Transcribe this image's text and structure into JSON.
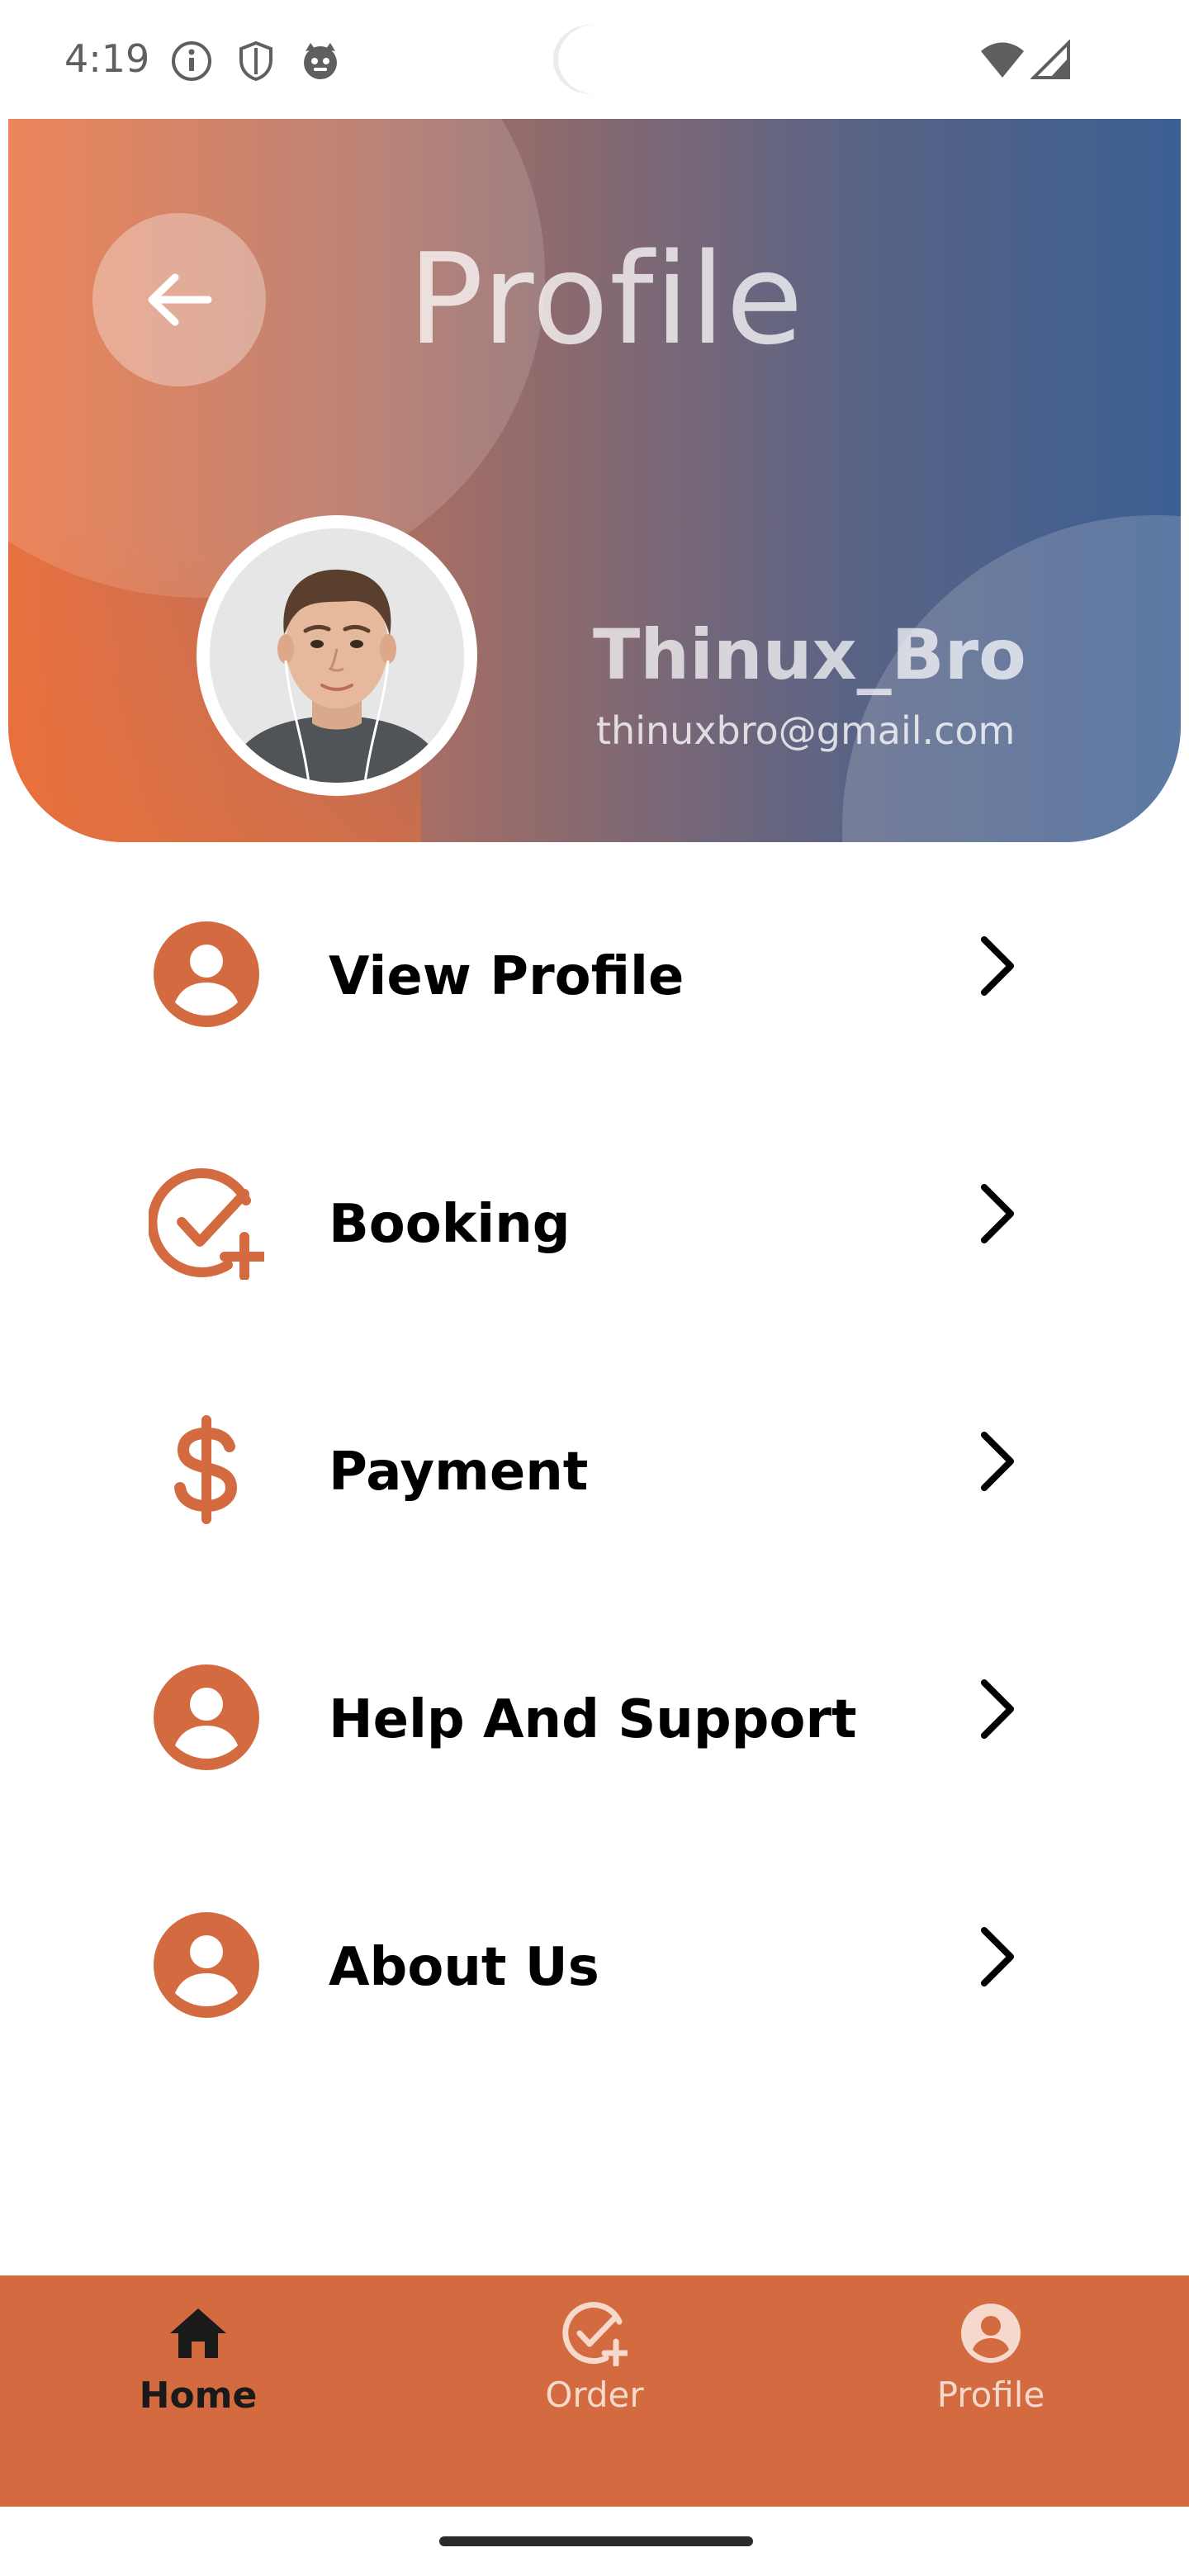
{
  "status_bar": {
    "time": "4:19",
    "left_icons": [
      "info-icon",
      "shield-icon",
      "cat-icon"
    ],
    "right_icons": [
      "wifi-icon",
      "cellular-signal-icon"
    ]
  },
  "header": {
    "title": "Profile",
    "back_icon": "arrow-left-icon",
    "user": {
      "name": "Thinux_Bro",
      "email": "thinuxbro@gmail.com"
    }
  },
  "menu": {
    "items": [
      {
        "label": "View Profile",
        "icon": "person-icon"
      },
      {
        "label": "Booking",
        "icon": "check-plus-icon"
      },
      {
        "label": "Payment",
        "icon": "dollar-icon"
      },
      {
        "label": "Help And Support",
        "icon": "person-icon"
      },
      {
        "label": "About Us",
        "icon": "person-icon"
      }
    ],
    "chevron_icon": "chevron-right-icon"
  },
  "bottom_nav": {
    "items": [
      {
        "label": "Home",
        "icon": "home-icon"
      },
      {
        "label": "Order",
        "icon": "check-plus-icon"
      },
      {
        "label": "Profile",
        "icon": "person-icon"
      }
    ]
  },
  "colors": {
    "accent": "#d46a3f",
    "header_gradient_start": "#e97140",
    "header_gradient_end": "#3b5f92",
    "nav_active_text": "#1a1a1a",
    "nav_inactive_text": "#f4d9cc"
  }
}
